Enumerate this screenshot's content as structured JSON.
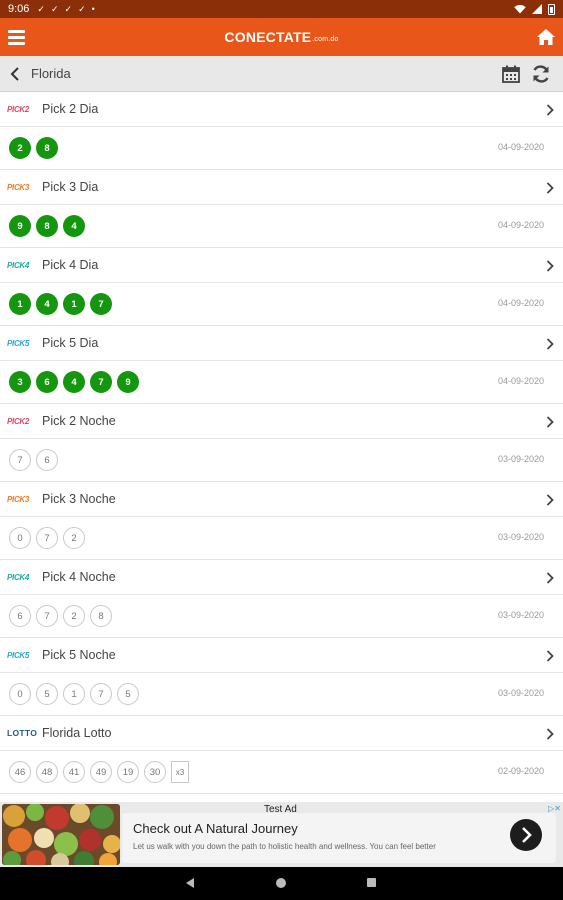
{
  "status_bar": {
    "time": "9:06",
    "notifications": [
      "✓",
      "✓",
      "✓",
      "✓",
      "•"
    ]
  },
  "header": {
    "logo_main": "CONECTATE",
    "logo_suffix": ".com.do",
    "menu_icon": "hamburger-menu-icon",
    "home_icon": "home-icon",
    "background_color": "#e8561a"
  },
  "sub_header": {
    "title": "Florida",
    "back_icon": "chevron-left-icon",
    "calendar_icon": "calendar-icon",
    "refresh_icon": "refresh-icon"
  },
  "colors": {
    "ball_green": "#14960f",
    "pick2_logo": "#e24763",
    "pick3_logo": "#ee7a2a",
    "pick4_logo": "#1fae9a",
    "pick5_logo": "#2ba6d6"
  },
  "games": [
    {
      "logo": "PICK2",
      "logo_color": "#e24763",
      "name": "Pick 2 Dia",
      "balls": [
        "2",
        "8"
      ],
      "style": "green",
      "date": "04-09-2020"
    },
    {
      "logo": "PICK3",
      "logo_color": "#ee7a2a",
      "name": "Pick 3 Dia",
      "balls": [
        "9",
        "8",
        "4"
      ],
      "style": "green",
      "date": "04-09-2020"
    },
    {
      "logo": "PICK4",
      "logo_color": "#1fae9a",
      "name": "Pick 4 Dia",
      "balls": [
        "1",
        "4",
        "1",
        "7"
      ],
      "style": "green",
      "date": "04-09-2020"
    },
    {
      "logo": "PICK5",
      "logo_color": "#2ba6d6",
      "name": "Pick 5 Dia",
      "balls": [
        "3",
        "6",
        "4",
        "7",
        "9"
      ],
      "style": "green",
      "date": "04-09-2020"
    },
    {
      "logo": "PICK2",
      "logo_color": "#e24763",
      "name": "Pick 2 Noche",
      "balls": [
        "7",
        "6"
      ],
      "style": "plain",
      "date": "03-09-2020"
    },
    {
      "logo": "PICK3",
      "logo_color": "#ee7a2a",
      "name": "Pick 3 Noche",
      "balls": [
        "0",
        "7",
        "2"
      ],
      "style": "plain",
      "date": "03-09-2020"
    },
    {
      "logo": "PICK4",
      "logo_color": "#1fae9a",
      "name": "Pick 4 Noche",
      "balls": [
        "6",
        "7",
        "2",
        "8"
      ],
      "style": "plain",
      "date": "03-09-2020"
    },
    {
      "logo": "PICK5",
      "logo_color": "#2ba6d6",
      "name": "Pick 5 Noche",
      "balls": [
        "0",
        "5",
        "1",
        "7",
        "5"
      ],
      "style": "plain",
      "date": "03-09-2020"
    },
    {
      "logo": "LOTTO",
      "logo_color": "#1b5e7a",
      "name": "Florida Lotto",
      "balls": [
        "46",
        "48",
        "41",
        "49",
        "19",
        "30"
      ],
      "style": "plain",
      "multiplier": "x3",
      "date": "02-09-2020"
    }
  ],
  "ad": {
    "label": "Test Ad",
    "title": "Check out A Natural Journey",
    "description": "Let us walk with you down the path to holistic health and wellness. You can feel better",
    "go_icon": "arrow-right-icon",
    "choices_icon": "adchoices-icon"
  },
  "nav_bar": {
    "back_icon": "nav-back-icon",
    "home_icon": "nav-home-icon",
    "recents_icon": "nav-recents-icon"
  }
}
